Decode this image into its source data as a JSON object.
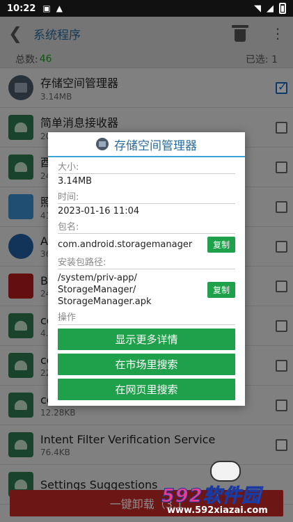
{
  "status_bar": {
    "time": "10:22",
    "notif_icons": [
      "a-icon",
      "warning-icon"
    ]
  },
  "app_bar": {
    "title": "系统程序"
  },
  "summary": {
    "total_label": "总数: ",
    "total_count": "46",
    "selected_label": "已选: 1"
  },
  "apps": [
    {
      "name": "存储空间管理器",
      "size": "3.14MB",
      "icon": "storage-icon",
      "checked": true
    },
    {
      "name": "简单消息接收器",
      "size": "20",
      "icon": "android-icon",
      "checked": false
    },
    {
      "name": "酉",
      "size": "24",
      "icon": "android-icon",
      "checked": false
    },
    {
      "name": "照",
      "size": "41",
      "icon": "files-icon",
      "checked": false
    },
    {
      "name": "A",
      "size": "36",
      "icon": "globe-icon",
      "checked": false
    },
    {
      "name": "B",
      "size": "24",
      "icon": "bookmark-icon",
      "checked": false
    },
    {
      "name": "co",
      "size": "4.",
      "icon": "android-icon",
      "checked": false
    },
    {
      "name": "co",
      "size": "22",
      "icon": "android-icon",
      "checked": false
    },
    {
      "name": "co",
      "size": "12.28KB",
      "icon": "android-icon",
      "checked": false
    },
    {
      "name": "Intent Filter Verification Service",
      "size": "76.4KB",
      "icon": "android-icon",
      "checked": false
    },
    {
      "name": "Settings Suggestions",
      "size": "",
      "icon": "android-icon",
      "checked": false
    }
  ],
  "uninstall_button": {
    "label": "一键卸载（3.1"
  },
  "dialog": {
    "title": "存储空间管理器",
    "size_label": "大小:",
    "size_value": "3.14MB",
    "time_label": "时间:",
    "time_value": "2023-01-16 11:04",
    "package_label": "包名:",
    "package_value": "com.android.storagemanager",
    "copy_label": "复制",
    "path_label": "安装包路径:",
    "path_value_line1": "/system/priv-app/",
    "path_value_line2": "StorageManager/",
    "path_value_line3": "StorageManager.apk",
    "actions_label": "操作",
    "action_details": "显示更多详情",
    "action_market": "在市场里搜索",
    "action_web": "在网页里搜索"
  },
  "watermark": {
    "logo_num": "592",
    "logo_text": "软件园",
    "url": "www.592xiazai.com"
  },
  "colors": {
    "accent_blue": "#2b6b9a",
    "green_button": "#1fa04a",
    "uninstall_red": "#c62828"
  }
}
